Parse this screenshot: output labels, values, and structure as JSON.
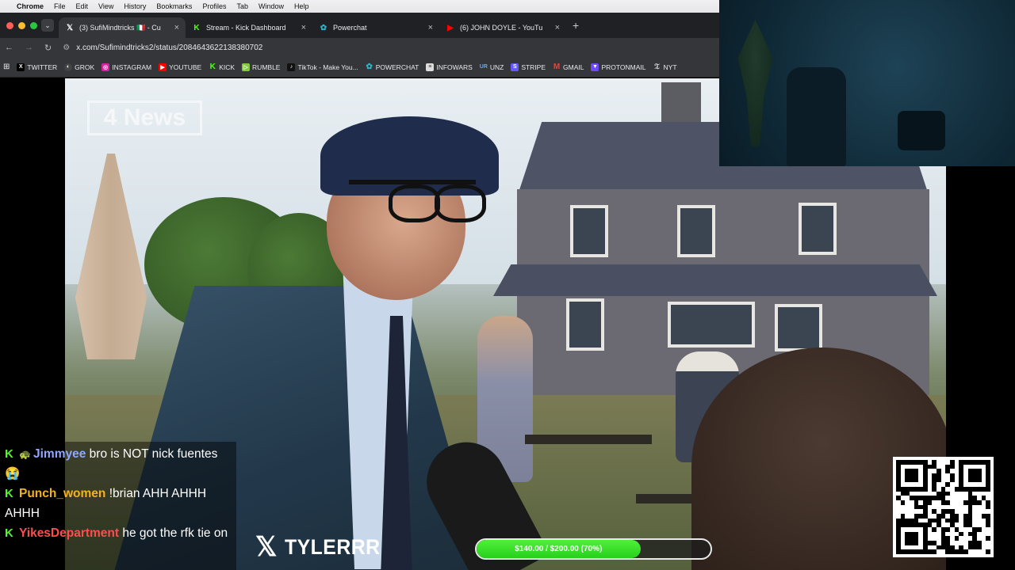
{
  "menubar": {
    "app": "Chrome",
    "items": [
      "File",
      "Edit",
      "View",
      "History",
      "Bookmarks",
      "Profiles",
      "Tab",
      "Window",
      "Help"
    ]
  },
  "tabs": [
    {
      "title": "(3) SufiMindtricks 🇮🇹 - Cu",
      "icon": "x-icon",
      "active": true
    },
    {
      "title": "Stream - Kick Dashboard",
      "icon": "kick-icon",
      "active": false
    },
    {
      "title": "Powerchat",
      "icon": "powerchat-icon",
      "active": false
    },
    {
      "title": "(6) JOHN DOYLE - YouTu",
      "icon": "youtube-icon",
      "active": false
    }
  ],
  "address": {
    "url": "x.com/Sufimindtricks2/status/2084643622138380702"
  },
  "bookmarks": [
    {
      "label": "TWITTER",
      "icon": "x-icon",
      "color": "#000000"
    },
    {
      "label": "GROK",
      "icon": "grok-icon",
      "color": "#444444"
    },
    {
      "label": "INSTAGRAM",
      "icon": "instagram-icon",
      "color": "#d6249f"
    },
    {
      "label": "YOUTUBE",
      "icon": "youtube-icon",
      "color": "#ff0000"
    },
    {
      "label": "KICK",
      "icon": "kick-icon",
      "color": "#53fc18"
    },
    {
      "label": "RUMBLE",
      "icon": "rumble-icon",
      "color": "#85c742"
    },
    {
      "label": "TikTok - Make You...",
      "icon": "tiktok-icon",
      "color": "#111111"
    },
    {
      "label": "POWERCHAT",
      "icon": "powerchat-icon",
      "color": "#2fb6c9"
    },
    {
      "label": "INFOWARS",
      "icon": "infowars-icon",
      "color": "#dddddd"
    },
    {
      "label": "UNZ",
      "icon": "unz-icon",
      "color": "#3b6cc9"
    },
    {
      "label": "STRIPE",
      "icon": "stripe-icon",
      "color": "#635bff"
    },
    {
      "label": "GMAIL",
      "icon": "gmail-icon",
      "color": "#ea4335"
    },
    {
      "label": "PROTONMAIL",
      "icon": "proton-icon",
      "color": "#6d4aff"
    },
    {
      "label": "NYT",
      "icon": "nyt-icon",
      "color": "#dddddd"
    }
  ],
  "video": {
    "watermark": "4 News"
  },
  "chat": [
    {
      "user": "Jimmyee",
      "color": "#8fa8ff",
      "badge": "🐢",
      "text": "bro is NOT nick fuentes 😭"
    },
    {
      "user": "Punch_women",
      "color": "#f5b21a",
      "badge": "",
      "text": "!brian AHH AHHH AHHH"
    },
    {
      "user": "YikesDepartment",
      "color": "#ff4d4d",
      "badge": "",
      "text": "he got the rfk tie on"
    }
  ],
  "overlay": {
    "x_handle": "TYLERRR",
    "goal_text": "$140.00 / $200.00 (70%)",
    "goal_fraction": 0.7
  }
}
